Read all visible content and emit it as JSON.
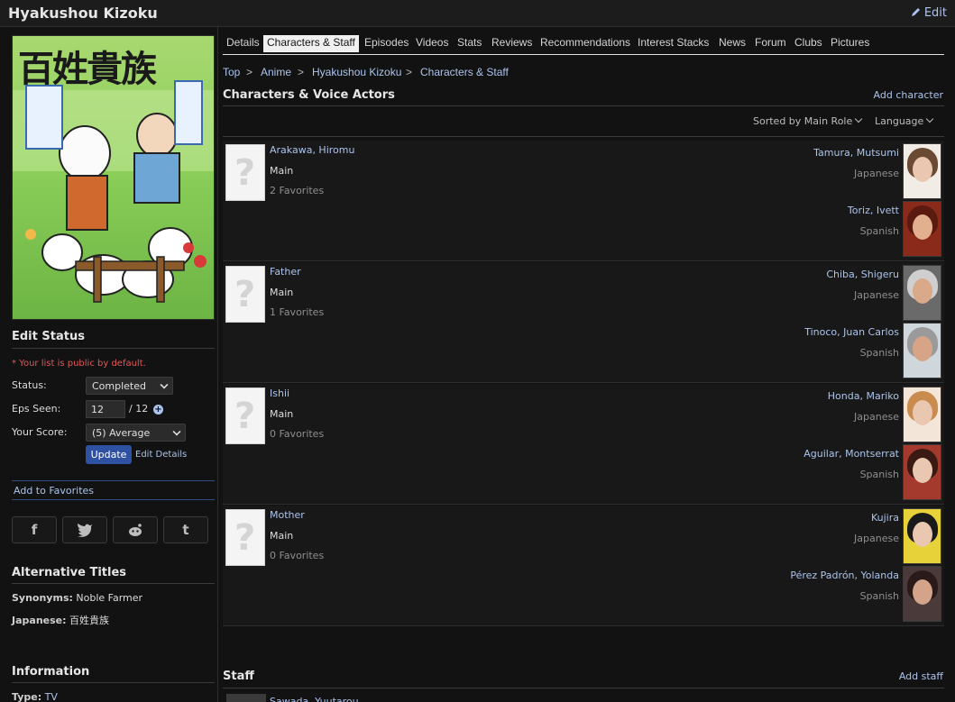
{
  "header": {
    "title": "Hyakushou Kizoku",
    "edit_label": "Edit"
  },
  "cover": {
    "kanji": "百姓貴族"
  },
  "edit_status": {
    "heading": "Edit Status",
    "note": "* Your list is public by default.",
    "status_label": "Status:",
    "status_value": "Completed",
    "eps_label": "Eps Seen:",
    "eps_value": "12",
    "eps_total": "/ 12",
    "score_label": "Your Score:",
    "score_value": "(5) Average",
    "update_label": "Update",
    "edit_details_label": "Edit Details"
  },
  "favorites_label": "Add to Favorites",
  "share_icons": [
    "f",
    "t",
    "r",
    "t"
  ],
  "alt_titles": {
    "heading": "Alternative Titles",
    "synonyms_label": "Synonyms:",
    "synonyms_value": "Noble Farmer",
    "japanese_label": "Japanese:",
    "japanese_value": "百姓貴族"
  },
  "information": {
    "heading": "Information",
    "type_label": "Type:",
    "type_value": "TV"
  },
  "tabs": [
    "Details",
    "Characters & Staff",
    "Episodes",
    "Videos",
    "Stats",
    "Reviews",
    "Recommendations",
    "Interest Stacks",
    "News",
    "Forum",
    "Clubs",
    "Pictures"
  ],
  "breadcrumb": [
    "Top",
    "Anime",
    "Hyakushou Kizoku",
    "Characters & Staff"
  ],
  "breadcrumb_sep": ">",
  "characters": {
    "heading": "Characters & Voice Actors",
    "add_label": "Add character",
    "sort_label": "Sorted by Main Role",
    "language_label": "Language",
    "rows": [
      {
        "name": "Arakawa, Hiromu",
        "role": "Main",
        "favorites": "2 Favorites",
        "va": [
          {
            "name": "Tamura, Mutsumi",
            "lang": "Japanese"
          },
          {
            "name": "Toriz, Ivett",
            "lang": "Spanish"
          }
        ]
      },
      {
        "name": "Father",
        "role": "Main",
        "favorites": "1 Favorites",
        "va": [
          {
            "name": "Chiba, Shigeru",
            "lang": "Japanese"
          },
          {
            "name": "Tinoco, Juan Carlos",
            "lang": "Spanish"
          }
        ]
      },
      {
        "name": "Ishii",
        "role": "Main",
        "favorites": "0 Favorites",
        "va": [
          {
            "name": "Honda, Mariko",
            "lang": "Japanese"
          },
          {
            "name": "Aguilar, Montserrat",
            "lang": "Spanish"
          }
        ]
      },
      {
        "name": "Mother",
        "role": "Main",
        "favorites": "0 Favorites",
        "va": [
          {
            "name": "Kujira",
            "lang": "Japanese"
          },
          {
            "name": "Pérez Padrón, Yolanda",
            "lang": "Spanish"
          }
        ]
      }
    ]
  },
  "staff": {
    "heading": "Staff",
    "add_label": "Add staff",
    "first_name": "Sawada, Yuutarou"
  },
  "colors": {
    "link": "#abc4ed",
    "button": "#2e51a2",
    "note": "#e05a5a"
  }
}
